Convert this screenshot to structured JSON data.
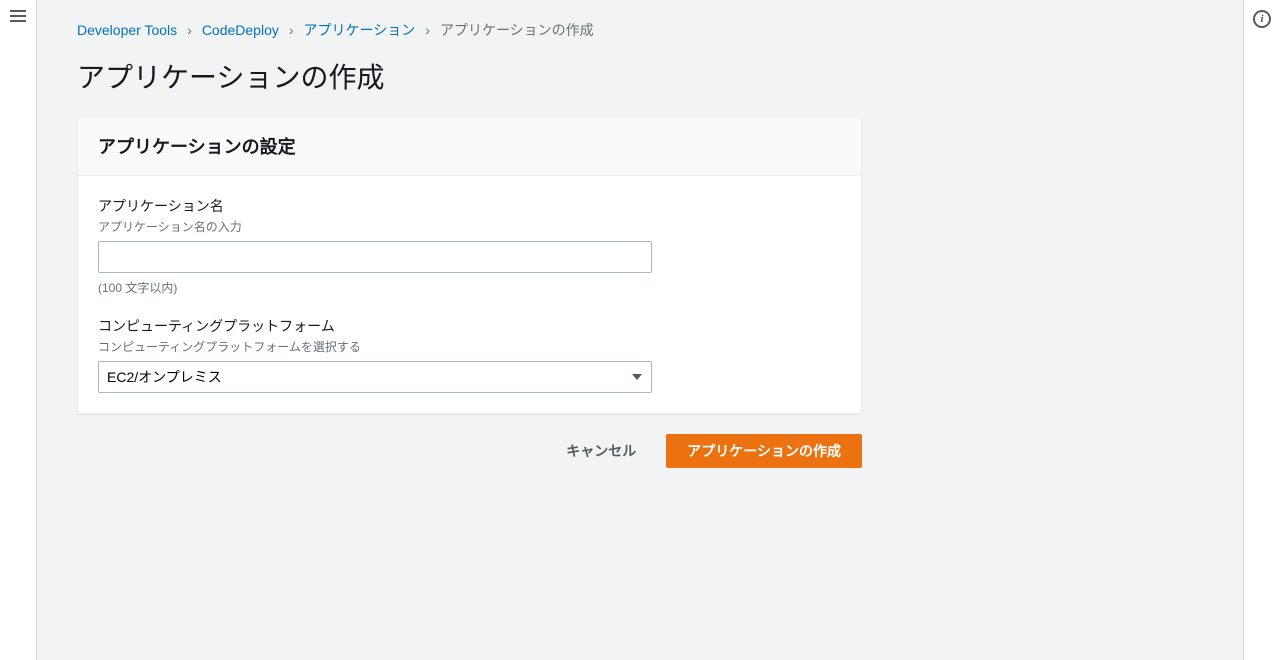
{
  "breadcrumb": {
    "items": [
      {
        "label": "Developer Tools"
      },
      {
        "label": "CodeDeploy"
      },
      {
        "label": "アプリケーション"
      }
    ],
    "current": "アプリケーションの作成"
  },
  "page_title": "アプリケーションの作成",
  "panel": {
    "title": "アプリケーションの設定",
    "app_name": {
      "label": "アプリケーション名",
      "description": "アプリケーション名の入力",
      "value": "",
      "hint": "(100 文字以内)"
    },
    "platform": {
      "label": "コンピューティングプラットフォーム",
      "description": "コンピューティングプラットフォームを選択する",
      "selected": "EC2/オンプレミス"
    }
  },
  "buttons": {
    "cancel": "キャンセル",
    "create": "アプリケーションの作成"
  }
}
